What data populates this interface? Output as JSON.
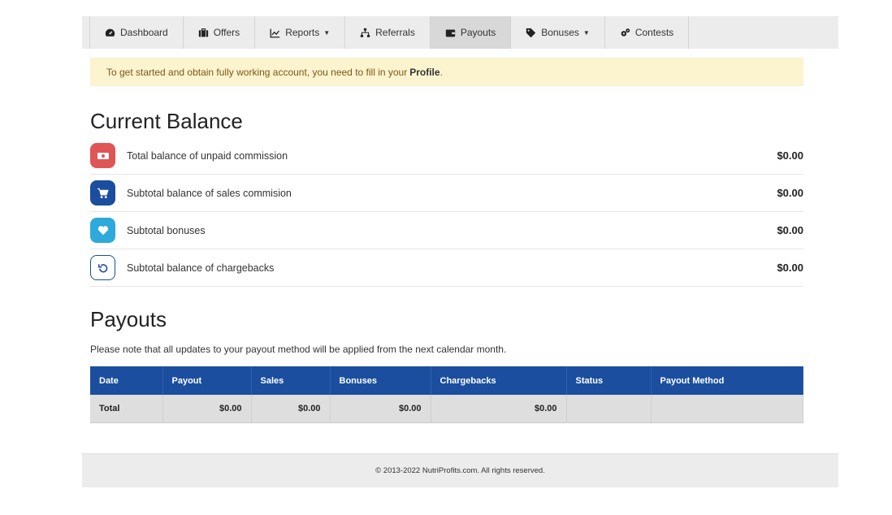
{
  "nav": {
    "items": [
      {
        "label": "Dashboard",
        "icon": "dashboard-icon",
        "caret": false,
        "active": false
      },
      {
        "label": "Offers",
        "icon": "briefcase-icon",
        "caret": false,
        "active": false
      },
      {
        "label": "Reports",
        "icon": "chart-line-icon",
        "caret": true,
        "active": false
      },
      {
        "label": "Referrals",
        "icon": "sitemap-icon",
        "caret": false,
        "active": false
      },
      {
        "label": "Payouts",
        "icon": "wallet-icon",
        "caret": false,
        "active": true
      },
      {
        "label": "Bonuses",
        "icon": "tag-icon",
        "caret": true,
        "active": false
      },
      {
        "label": "Contests",
        "icon": "cogs-icon",
        "caret": false,
        "active": false
      }
    ]
  },
  "alert": {
    "text": "To get started and obtain fully working account, you need to fill in your",
    "link": "Profile",
    "suffix": "."
  },
  "balance": {
    "title": "Current Balance",
    "rows": [
      {
        "label": "Total balance of unpaid commission",
        "value": "$0.00",
        "icon": "money-icon",
        "color": "#e05555"
      },
      {
        "label": "Subtotal balance of sales commision",
        "value": "$0.00",
        "icon": "cart-icon",
        "color": "#1b4e9e"
      },
      {
        "label": "Subtotal bonuses",
        "value": "$0.00",
        "icon": "heart-icon",
        "color": "#2ea9dc"
      },
      {
        "label": "Subtotal balance of chargebacks",
        "value": "$0.00",
        "icon": "undo-icon",
        "color": "#ffffff"
      }
    ]
  },
  "payouts": {
    "title": "Payouts",
    "note": "Please note that all updates to your payout method will be applied from the next calendar month.",
    "columns": [
      "Date",
      "Payout",
      "Sales",
      "Bonuses",
      "Chargebacks",
      "Status",
      "Payout Method"
    ],
    "total_row": [
      "Total",
      "$0.00",
      "$0.00",
      "$0.00",
      "$0.00",
      "",
      ""
    ]
  },
  "footer": {
    "text": "© 2013-2022 NutriProfits.com. All rights reserved."
  },
  "colors": {
    "header_blue": "#1b4e9e",
    "alert_bg": "#fcf3cf"
  }
}
